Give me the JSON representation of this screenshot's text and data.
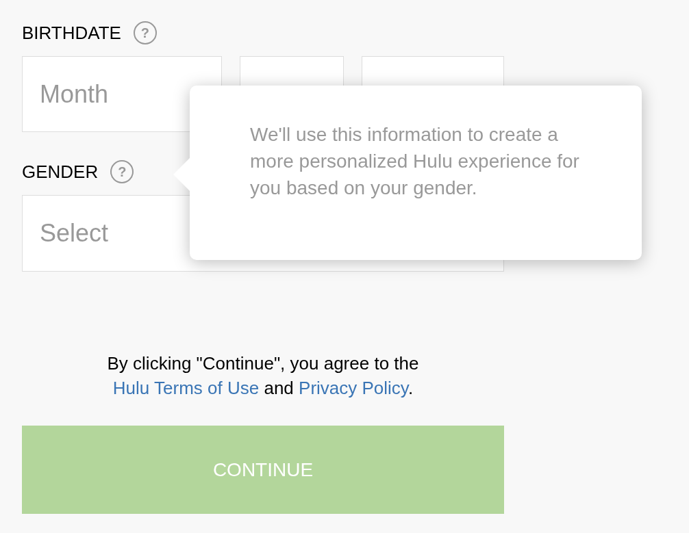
{
  "birthdate": {
    "label": "BIRTHDATE",
    "help": "?",
    "fields": [
      {
        "kind": "month",
        "placeholder": "Month"
      },
      {
        "kind": "day"
      },
      {
        "kind": "year"
      }
    ]
  },
  "gender": {
    "label": "GENDER",
    "help": "?",
    "select": {
      "placeholder": "Select"
    }
  },
  "tooltip": {
    "text": "We'll use this information to create a more personalized Hulu experience for you based on your gender."
  },
  "terms": {
    "before": "By clicking \"Continue\", you agree to the",
    "link1": "Hulu Terms of Use",
    "middle": "and",
    "link2": "Privacy Policy",
    "after": "."
  },
  "continue_button": {
    "label": "CONTINUE"
  }
}
